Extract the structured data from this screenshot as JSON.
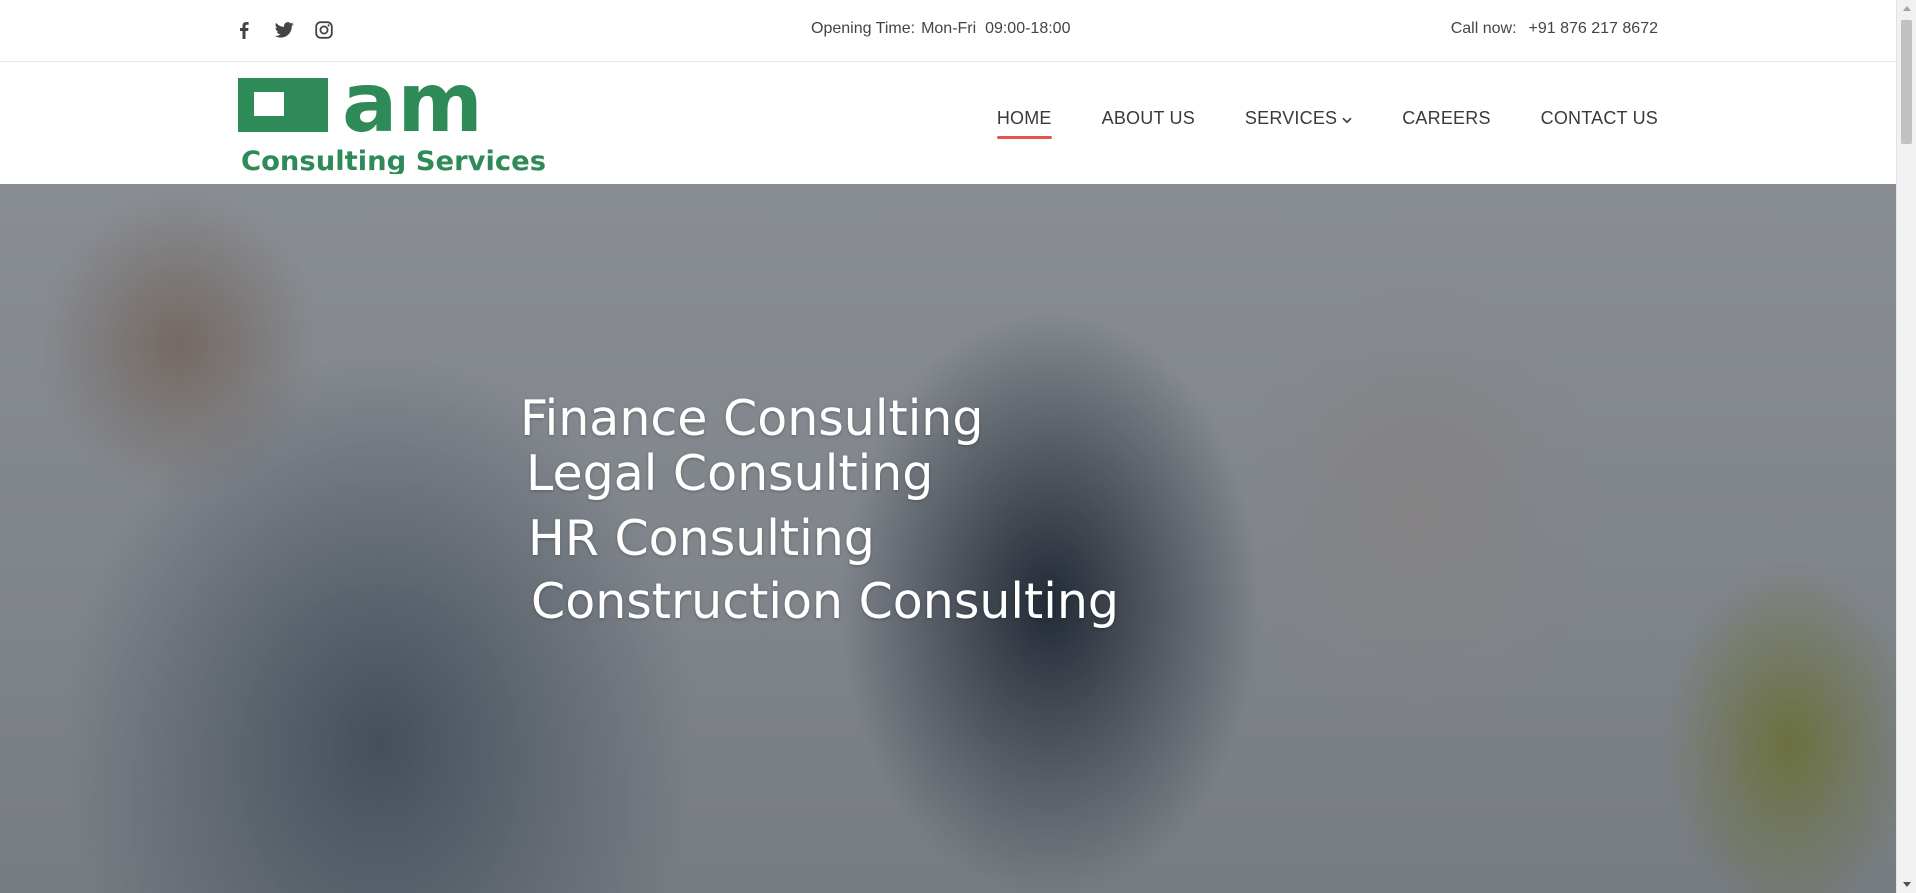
{
  "topbar": {
    "social": [
      {
        "icon": "facebook-icon"
      },
      {
        "icon": "twitter-icon"
      },
      {
        "icon": "instagram-icon"
      }
    ],
    "opening_label": "Opening Time:",
    "opening_value": "Mon-Fri  09:00-18:00",
    "call_label": "Call now:",
    "call_value": "+91 876 217 8672"
  },
  "logo": {
    "mark_text": "am",
    "sub_text": "Consulting Services",
    "color": "#2e8b57"
  },
  "nav": {
    "items": [
      {
        "label": "HOME",
        "active": true
      },
      {
        "label": "ABOUT US"
      },
      {
        "label": "SERVICES",
        "has_dropdown": true
      },
      {
        "label": "CAREERS"
      },
      {
        "label": "CONTACT US"
      }
    ],
    "active_color": "#e8554e"
  },
  "hero": {
    "lines": [
      "Finance Consulting",
      "Legal Consulting",
      "HR Consulting",
      "Construction Consulting"
    ]
  }
}
